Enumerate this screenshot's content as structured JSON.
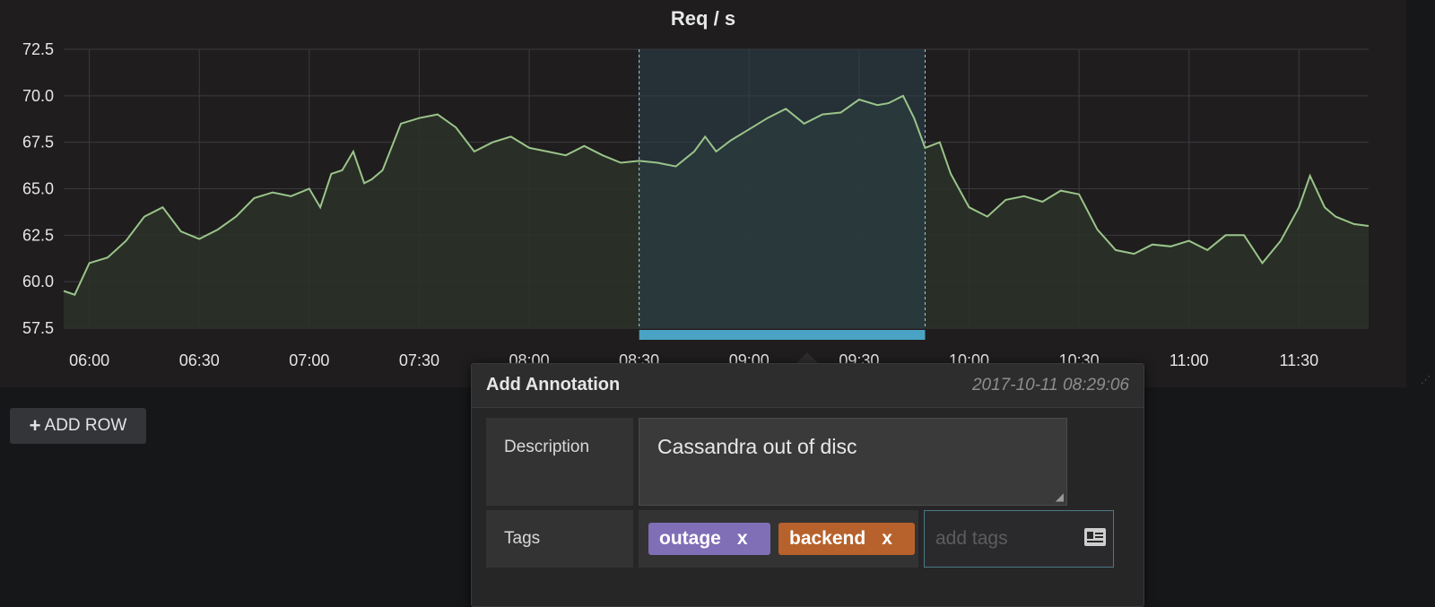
{
  "panel": {
    "title": "Req / s"
  },
  "toolbar": {
    "add_row_label": "ADD ROW",
    "add_row_icon": "plus-icon"
  },
  "annotation": {
    "title": "Add Annotation",
    "timestamp": "2017-10-11 08:29:06",
    "description_label": "Description",
    "description_value": "Cassandra out of disc",
    "tags_label": "Tags",
    "tags": [
      {
        "label": "outage",
        "remove": "x",
        "color": "#806eb7"
      },
      {
        "label": "backend",
        "remove": "x",
        "color": "#b7622c"
      }
    ],
    "tag_input_placeholder": "add tags",
    "tag_input_icon": "id-card-icon"
  },
  "colors": {
    "background": "#161719",
    "panel": "#1f1d1e",
    "line": "#9ac48a",
    "fill": "#2b3328",
    "selection": "#29404d",
    "selection_marker": "#4aa3c4"
  },
  "chart_data": {
    "type": "area",
    "title": "Req / s",
    "xlabel": "",
    "ylabel": "",
    "ylim": [
      57.5,
      72.5
    ],
    "xlim": [
      "05:53",
      "11:49"
    ],
    "yticks": [
      "57.5",
      "60.0",
      "62.5",
      "65.0",
      "67.5",
      "70.0",
      "72.5"
    ],
    "xticks": [
      "06:00",
      "06:30",
      "07:00",
      "07:30",
      "08:00",
      "08:30",
      "09:00",
      "09:30",
      "10:00",
      "10:30",
      "11:00",
      "11:30"
    ],
    "grid": true,
    "selected_region": [
      "08:30",
      "09:48"
    ],
    "series": [
      {
        "x": [
          "05:53",
          "05:56",
          "06:00",
          "06:05",
          "06:10",
          "06:15",
          "06:20",
          "06:25",
          "06:30",
          "06:35",
          "06:40",
          "06:45",
          "06:50",
          "06:55",
          "07:00",
          "07:03",
          "07:06",
          "07:09",
          "07:12",
          "07:15",
          "07:17",
          "07:20",
          "07:25",
          "07:30",
          "07:35",
          "07:40",
          "07:45",
          "07:50",
          "07:55",
          "08:00",
          "08:05",
          "08:10",
          "08:15",
          "08:20",
          "08:25",
          "08:30",
          "08:35",
          "08:40",
          "08:45",
          "08:48",
          "08:51",
          "08:55",
          "09:00",
          "09:05",
          "09:10",
          "09:15",
          "09:20",
          "09:25",
          "09:30",
          "09:35",
          "09:38",
          "09:42",
          "09:45",
          "09:48",
          "09:52",
          "09:55",
          "10:00",
          "10:05",
          "10:10",
          "10:15",
          "10:20",
          "10:25",
          "10:30",
          "10:35",
          "10:40",
          "10:45",
          "10:50",
          "10:55",
          "11:00",
          "11:05",
          "11:10",
          "11:15",
          "11:20",
          "11:25",
          "11:30",
          "11:33",
          "11:37",
          "11:40",
          "11:45",
          "11:49"
        ],
        "y": [
          59.5,
          59.3,
          61.0,
          61.3,
          62.2,
          63.5,
          64.0,
          62.7,
          62.3,
          62.8,
          63.5,
          64.5,
          64.8,
          64.6,
          65.0,
          64.0,
          65.8,
          66.0,
          67.0,
          65.3,
          65.5,
          66.0,
          68.5,
          68.8,
          69.0,
          68.3,
          67.0,
          67.5,
          67.8,
          67.2,
          67.0,
          66.8,
          67.3,
          66.8,
          66.4,
          66.5,
          66.4,
          66.2,
          67.0,
          67.8,
          67.0,
          67.6,
          68.2,
          68.8,
          69.3,
          68.5,
          69.0,
          69.1,
          69.8,
          69.5,
          69.6,
          70.0,
          68.8,
          67.2,
          67.5,
          65.8,
          64.0,
          63.5,
          64.4,
          64.6,
          64.3,
          64.9,
          64.7,
          62.8,
          61.7,
          61.5,
          62.0,
          61.9,
          62.2,
          61.7,
          62.5,
          62.5,
          61.0,
          62.2,
          64.0,
          65.7,
          64.0,
          63.5,
          63.1,
          63.0
        ]
      }
    ]
  }
}
